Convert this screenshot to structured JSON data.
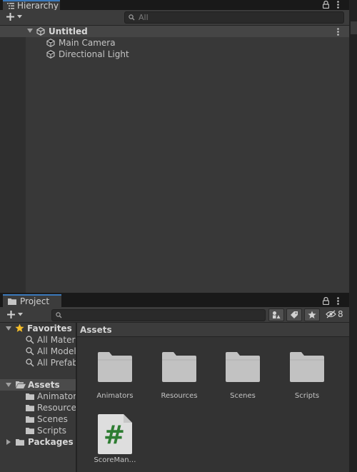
{
  "hierarchy": {
    "tab_title": "Hierarchy",
    "search_placeholder": "All",
    "scene_name": "Untitled",
    "items": [
      {
        "label": "Main Camera"
      },
      {
        "label": "Directional Light"
      }
    ]
  },
  "project": {
    "tab_title": "Project",
    "hidden_count": "8",
    "breadcrumb": "Assets",
    "tree": {
      "favorites_label": "Favorites",
      "favorites": [
        "All Materi",
        "All Model",
        "All Prefab"
      ],
      "assets_label": "Assets",
      "assets_children": [
        "Animators",
        "Resource",
        "Scenes",
        "Scripts"
      ],
      "packages_label": "Packages"
    },
    "grid_items": [
      {
        "label": "Animators",
        "icon": "folder-icon"
      },
      {
        "label": "Resources",
        "icon": "folder-icon"
      },
      {
        "label": "Scenes",
        "icon": "folder-icon"
      },
      {
        "label": "Scripts",
        "icon": "folder-icon"
      },
      {
        "label": "ScoreMan…",
        "icon": "csharp-script-icon"
      }
    ]
  },
  "colors": {
    "accent": "#3a79bb",
    "star": "#f4bd2a",
    "script_hash": "#2e7d32"
  }
}
